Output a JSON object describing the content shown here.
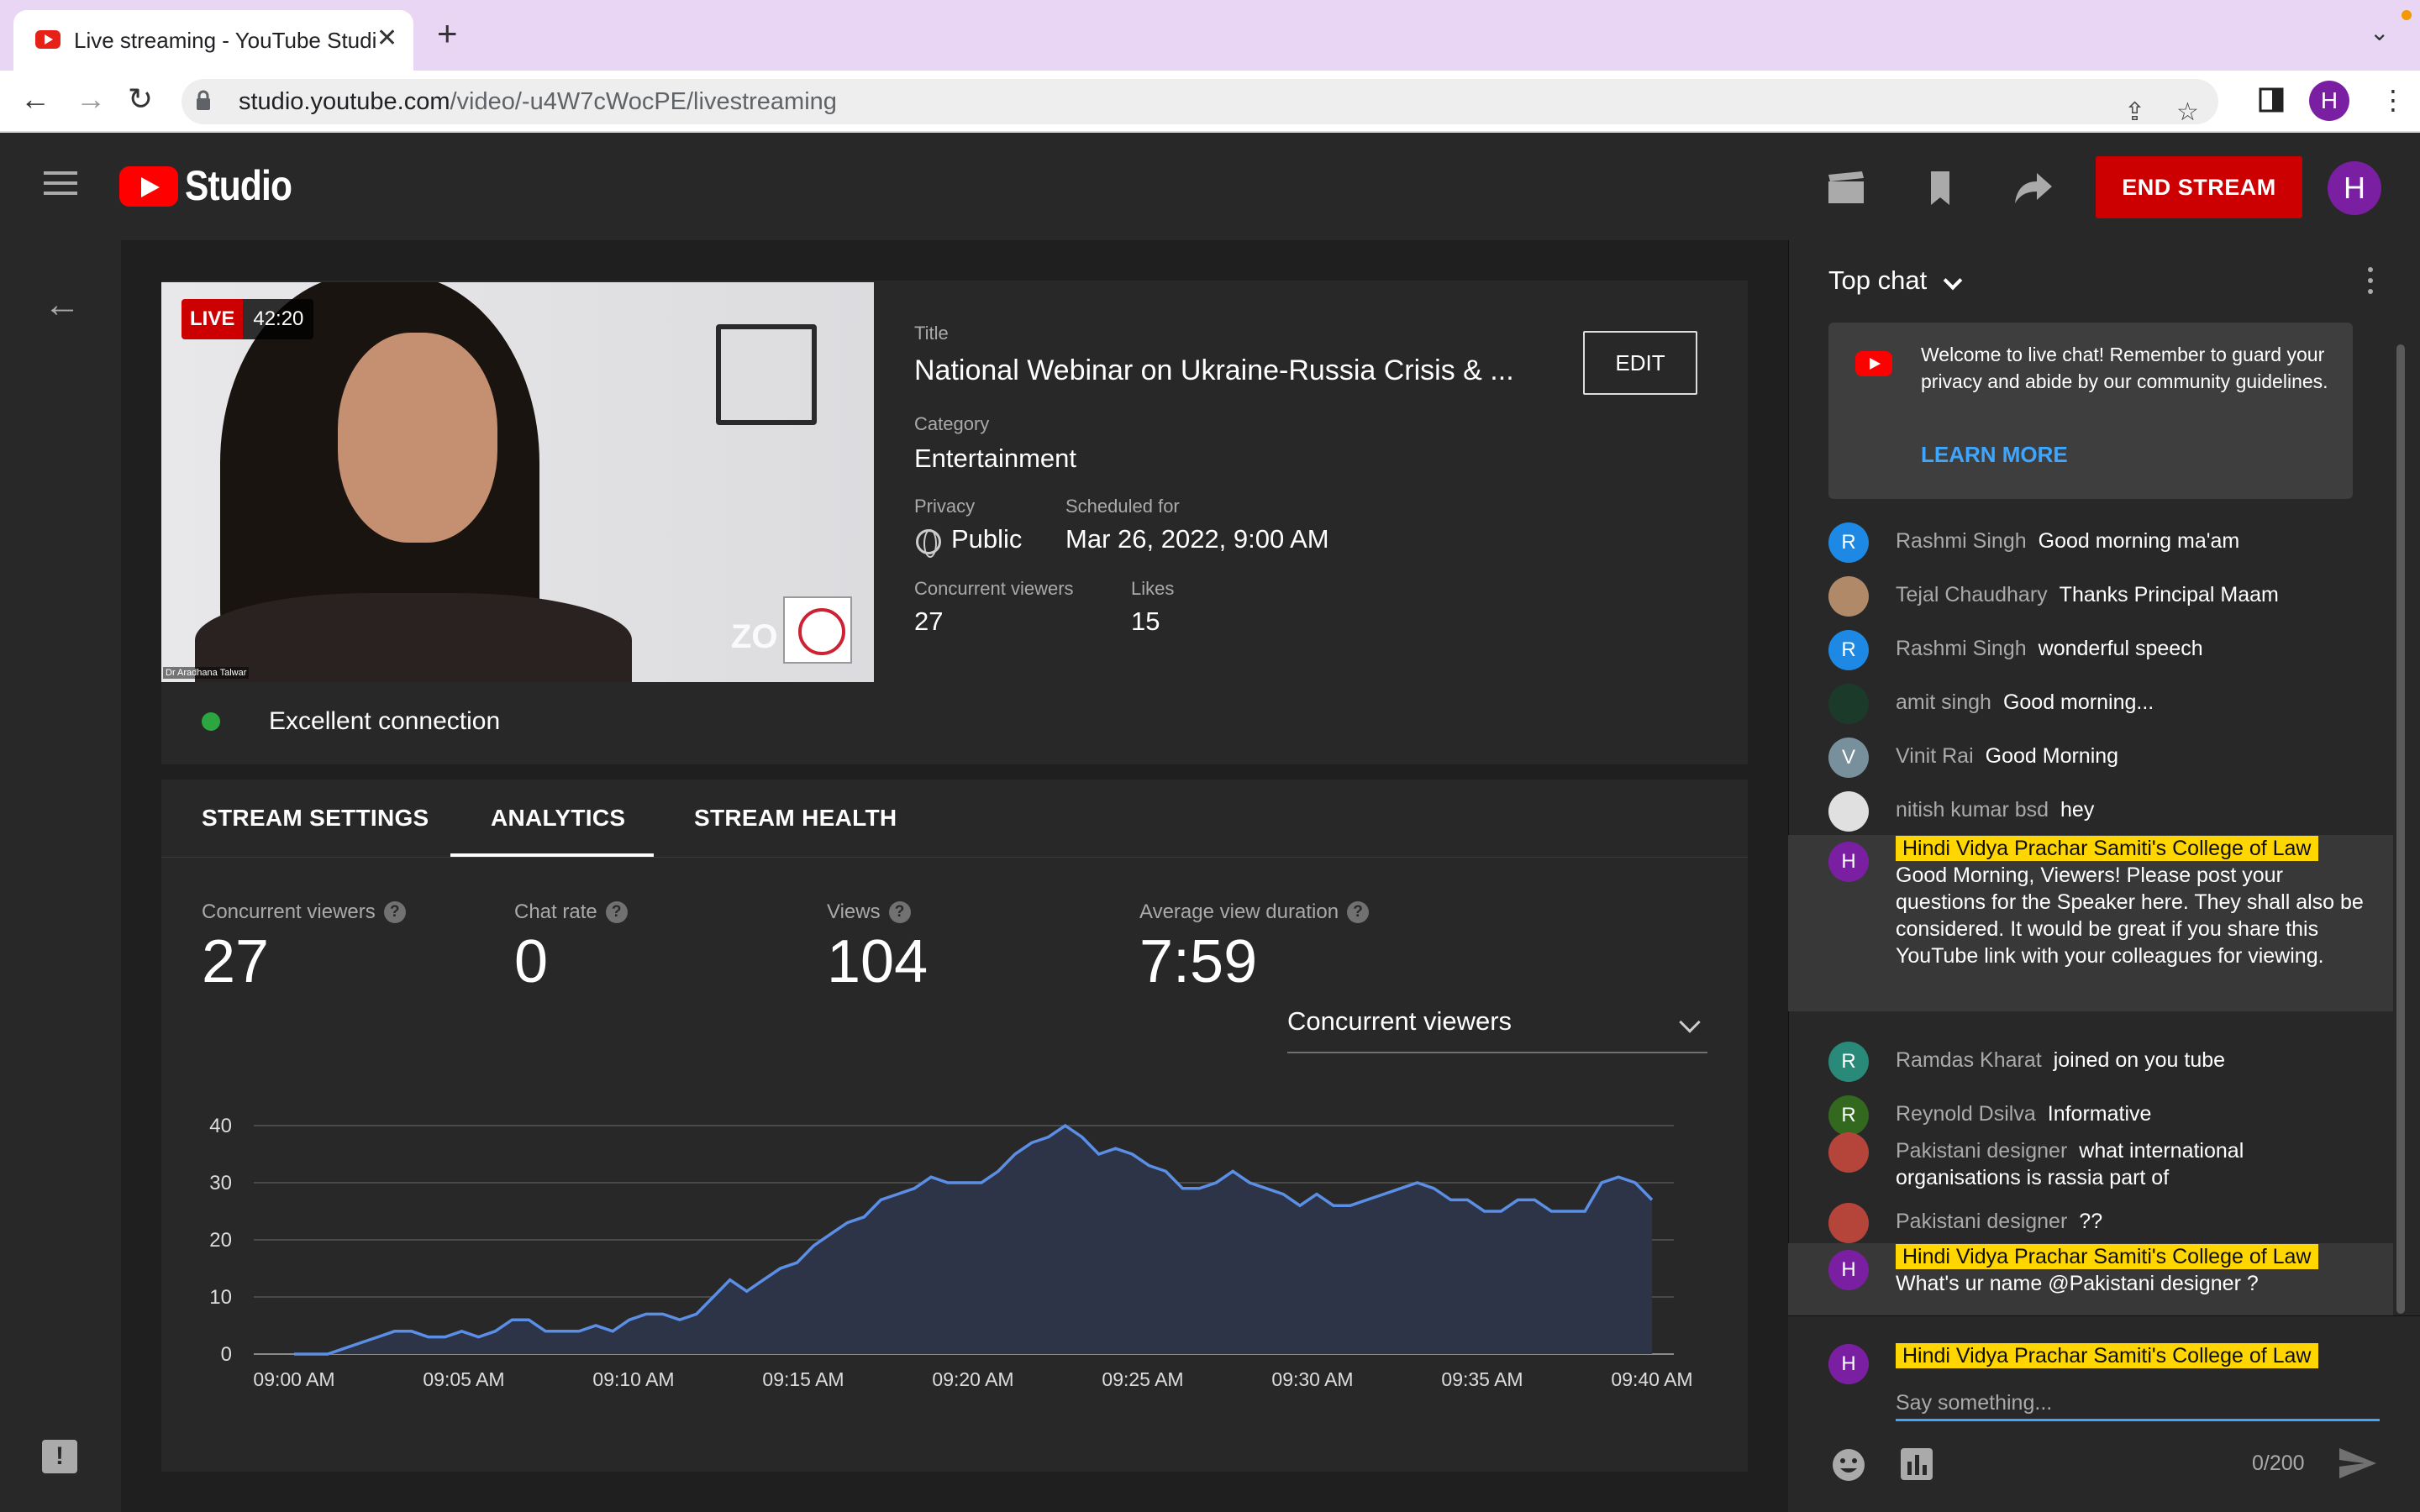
{
  "browser": {
    "tab_title": "Live streaming - YouTube Studio",
    "url_host": "studio.youtube.com",
    "url_path": "/video/-u4W7cWocPE/livestreaming",
    "profile_initial": "H"
  },
  "header": {
    "logo_text": "Studio",
    "end_stream_label": "END STREAM",
    "avatar_initial": "H"
  },
  "stream": {
    "live_label": "LIVE",
    "live_time": "42:20",
    "presenter_caption": "Dr Aradhana Talwar",
    "overlay_text": "ZO",
    "connection": "Excellent connection",
    "title_label": "Title",
    "title": "National Webinar on Ukraine-Russia Crisis & ...",
    "edit_label": "EDIT",
    "category_label": "Category",
    "category": "Entertainment",
    "privacy_label": "Privacy",
    "privacy": "Public",
    "scheduled_label": "Scheduled for",
    "scheduled": "Mar 26, 2022, 9:00 AM",
    "viewers_label": "Concurrent viewers",
    "viewers": "27",
    "likes_label": "Likes",
    "likes": "15"
  },
  "tabs": [
    "STREAM SETTINGS",
    "ANALYTICS",
    "STREAM HEALTH"
  ],
  "metrics": [
    {
      "label": "Concurrent viewers",
      "value": "27"
    },
    {
      "label": "Chat rate",
      "value": "0"
    },
    {
      "label": "Views",
      "value": "104"
    },
    {
      "label": "Average view duration",
      "value": "7:59"
    }
  ],
  "metric_dropdown": "Concurrent viewers",
  "colors": {
    "accent": "#3ea6ff",
    "live": "#cc0000",
    "line": "#5b8fe6",
    "area": "#2e3447",
    "ok": "#2ba640",
    "badge": "#ffd600"
  },
  "chart_data": {
    "type": "area",
    "title": "",
    "xlabel": "",
    "ylabel": "",
    "ylim": [
      0,
      40
    ],
    "yticks": [
      0,
      10,
      20,
      30,
      40
    ],
    "xticks": [
      "09:00 AM",
      "09:05 AM",
      "09:10 AM",
      "09:15 AM",
      "09:20 AM",
      "09:25 AM",
      "09:30 AM",
      "09:35 AM",
      "09:40 AM"
    ],
    "x_range_minutes": [
      0,
      40
    ],
    "values": [
      0,
      0,
      0,
      1,
      2,
      3,
      4,
      4,
      3,
      3,
      4,
      3,
      4,
      6,
      6,
      4,
      4,
      4,
      5,
      4,
      6,
      7,
      7,
      6,
      7,
      10,
      13,
      11,
      13,
      15,
      16,
      19,
      21,
      23,
      24,
      27,
      28,
      29,
      31,
      30,
      30,
      30,
      32,
      35,
      37,
      38,
      40,
      38,
      35,
      36,
      35,
      33,
      32,
      29,
      29,
      30,
      32,
      30,
      29,
      28,
      26,
      28,
      26,
      26,
      27,
      28,
      29,
      30,
      29,
      27,
      27,
      25,
      25,
      27,
      27,
      25,
      25,
      25,
      30,
      31,
      30,
      27
    ],
    "grid": true,
    "legend": "none"
  },
  "chat": {
    "header": "Top chat",
    "welcome": "Welcome to live chat! Remember to guard your privacy and abide by our community guidelines.",
    "learn_more": "LEARN MORE",
    "messages": [
      {
        "author": "Rashmi Singh",
        "text": "Good morning ma'am",
        "initial": "R",
        "color": "#1e88e5"
      },
      {
        "author": "Tejal Chaudhary",
        "text": "Thanks Principal Maam",
        "initial": "",
        "color": "#b08968"
      },
      {
        "author": "Rashmi Singh",
        "text": "wonderful speech",
        "initial": "R",
        "color": "#1e88e5"
      },
      {
        "author": "amit singh",
        "text": "Good morning...",
        "initial": "",
        "color": "#1c3a2a"
      },
      {
        "author": "Vinit Rai",
        "text": "Good Morning",
        "initial": "V",
        "color": "#78909c"
      },
      {
        "author": "nitish kumar bsd",
        "text": "hey",
        "initial": "",
        "color": "#e0e0e0"
      },
      {
        "author": "Hindi Vidya Prachar Samiti's College of Law",
        "text": "Good Morning, Viewers! Please post your questions for the Speaker here. They shall also be considered. It would be great if you share this YouTube link with your colleagues for viewing.",
        "initial": "H",
        "color": "#7b1fa2"
      },
      {
        "author": "Ramdas Kharat",
        "text": "joined on you tube",
        "initial": "R",
        "color": "#2a8a7a"
      },
      {
        "author": "Reynold Dsilva",
        "text": "Informative",
        "initial": "R",
        "color": "#33691e"
      },
      {
        "author": "Pakistani designer",
        "text": "what international organisations is rassia part of",
        "initial": "",
        "color": "#b5453a"
      },
      {
        "author": "Pakistani designer",
        "text": "??",
        "initial": "",
        "color": "#b5453a"
      },
      {
        "author": "Hindi Vidya Prachar Samiti's College of Law",
        "text": "What's ur name @Pakistani designer ?",
        "initial": "H",
        "color": "#7b1fa2"
      }
    ],
    "input_author": "Hindi Vidya Prachar Samiti's College of Law",
    "input_placeholder": "Say something...",
    "char_count": "0/200"
  }
}
